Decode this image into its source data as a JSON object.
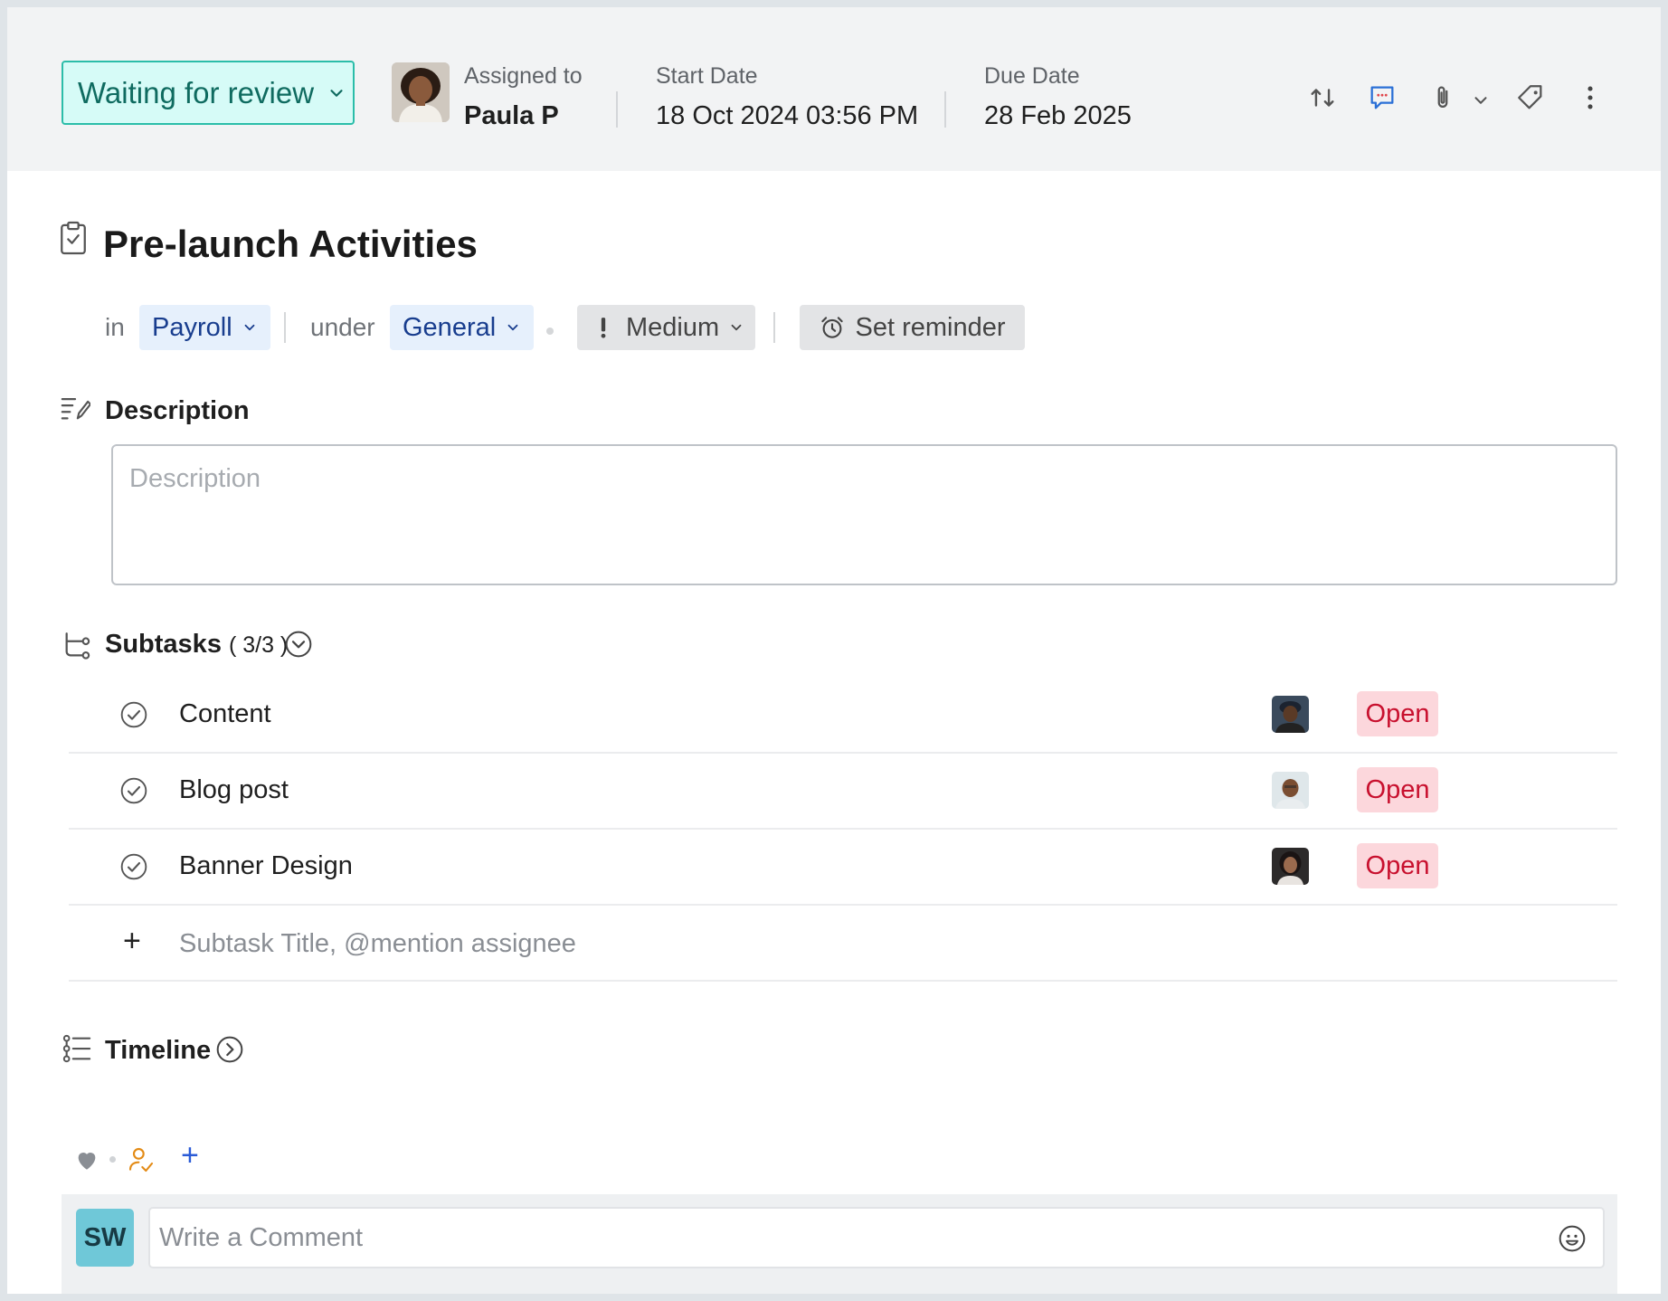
{
  "header": {
    "status": "Waiting for review",
    "assigned_label": "Assigned to",
    "assignee": "Paula P",
    "start_label": "Start Date",
    "start_value": "18 Oct 2024 03:56 PM",
    "due_label": "Due Date",
    "due_value": "28 Feb 2025",
    "icons": [
      "convert-icon",
      "comment-icon",
      "attachment-icon",
      "chevron-down-icon",
      "tag-icon",
      "more-vertical-icon"
    ]
  },
  "task": {
    "title": "Pre-launch Activities",
    "in_label": "in",
    "project": "Payroll",
    "under_label": "under",
    "tasklist": "General",
    "priority": "Medium",
    "reminder": "Set reminder"
  },
  "description": {
    "heading": "Description",
    "placeholder": "Description"
  },
  "subtasks": {
    "heading": "Subtasks",
    "count": "( 3/3 )",
    "items": [
      {
        "name": "Content",
        "status": "Open"
      },
      {
        "name": "Blog post",
        "status": "Open"
      },
      {
        "name": "Banner Design",
        "status": "Open"
      }
    ],
    "add_placeholder": "Subtask Title, @mention assignee",
    "add_symbol": "+"
  },
  "timeline": {
    "heading": "Timeline"
  },
  "footer": {
    "add_symbol": "+",
    "user_initials": "SW",
    "comment_placeholder": "Write a Comment"
  },
  "colors": {
    "status_border": "#2bbda9",
    "status_bg": "#d6fbf7",
    "chip_blue_bg": "#e6f0fc",
    "open_badge_bg": "#fcd7dc",
    "open_badge_text": "#c8102e",
    "avatar_sw": "#6fc8d8"
  }
}
